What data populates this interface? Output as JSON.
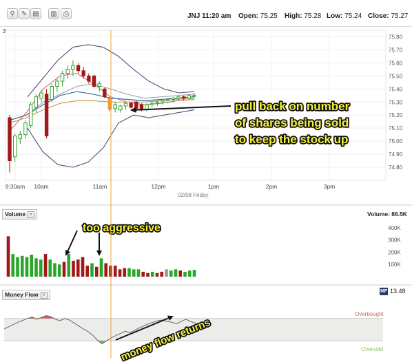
{
  "toolbar": {
    "buttons": [
      {
        "icon": "search-icon",
        "glyph": "⚲"
      },
      {
        "icon": "pencil-icon",
        "glyph": "✎"
      },
      {
        "icon": "document-icon",
        "glyph": "▤"
      },
      {
        "icon": "chart-icon",
        "glyph": "▥"
      },
      {
        "icon": "print-icon",
        "glyph": "⎙"
      }
    ]
  },
  "quote": {
    "symbol_time": "JNJ 11:20 am",
    "open_label": "Open:",
    "open": "75.25",
    "high_label": "High:",
    "high": "75.28",
    "low_label": "Low:",
    "low": "75.24",
    "close_label": "Close:",
    "close": "75.27"
  },
  "price_panel": {
    "corner_label": "3",
    "date_label": "02/08 Friday"
  },
  "volume_panel": {
    "title": "Volume",
    "value_label": "Volume: 86.5K"
  },
  "money_flow_panel": {
    "title": "Money Flow",
    "badge": "MF",
    "value": "13.48",
    "overbought_label": "Overbought",
    "oversold_label": "Oversold"
  },
  "annotations": {
    "pullback_lines": [
      "pull back on number",
      "of shares being sold",
      "to keep the stock up"
    ],
    "aggressive": "too aggressive",
    "money_flow": "money flow returns"
  },
  "colors": {
    "up": "#2aa62a",
    "down": "#a01818",
    "neutral": "#999999",
    "orange_marker": "#f0a030",
    "annotation_text": "#f5f03a"
  },
  "chart_data": [
    {
      "type": "candlestick",
      "x_ticks": [
        "9:30am",
        "10am",
        "11am",
        "12pm",
        "1pm",
        "2pm",
        "3pm"
      ],
      "ylim": [
        74.7,
        75.85
      ],
      "y_ticks": [
        74.8,
        74.9,
        75.0,
        75.1,
        75.2,
        75.3,
        75.4,
        75.5,
        75.6,
        75.7,
        75.8
      ],
      "y_tick_labels": [
        "74.80",
        "74.90",
        "75.00",
        "75.10",
        "75.20",
        "75.30",
        "75.40",
        "75.50",
        "75.60",
        "75.70",
        "75.80"
      ],
      "candles": [
        {
          "o": 75.18,
          "h": 75.2,
          "l": 74.76,
          "c": 74.85
        },
        {
          "o": 74.88,
          "h": 75.06,
          "l": 74.84,
          "c": 75.04
        },
        {
          "o": 75.02,
          "h": 75.08,
          "l": 74.98,
          "c": 75.05
        },
        {
          "o": 75.05,
          "h": 75.16,
          "l": 75.02,
          "c": 75.14
        },
        {
          "o": 75.12,
          "h": 75.3,
          "l": 75.1,
          "c": 75.28
        },
        {
          "o": 75.26,
          "h": 75.36,
          "l": 75.22,
          "c": 75.34
        },
        {
          "o": 75.33,
          "h": 75.39,
          "l": 75.3,
          "c": 75.37
        },
        {
          "o": 75.36,
          "h": 75.4,
          "l": 75.02,
          "c": 75.04
        },
        {
          "o": 75.32,
          "h": 75.44,
          "l": 75.3,
          "c": 75.42
        },
        {
          "o": 75.42,
          "h": 75.48,
          "l": 75.38,
          "c": 75.46
        },
        {
          "o": 75.46,
          "h": 75.54,
          "l": 75.42,
          "c": 75.52
        },
        {
          "o": 75.52,
          "h": 75.58,
          "l": 75.48,
          "c": 75.55
        },
        {
          "o": 75.55,
          "h": 75.62,
          "l": 75.5,
          "c": 75.58
        },
        {
          "o": 75.58,
          "h": 75.6,
          "l": 75.52,
          "c": 75.54
        },
        {
          "o": 75.54,
          "h": 75.57,
          "l": 75.48,
          "c": 75.5
        },
        {
          "o": 75.5,
          "h": 75.52,
          "l": 75.44,
          "c": 75.46
        },
        {
          "o": 75.5,
          "h": 75.51,
          "l": 75.41,
          "c": 75.42
        },
        {
          "o": 75.42,
          "h": 75.46,
          "l": 75.38,
          "c": 75.44
        },
        {
          "o": 75.4,
          "h": 75.41,
          "l": 75.33,
          "c": 75.34
        },
        {
          "o": 75.33,
          "h": 75.34,
          "l": 75.23,
          "c": 75.25
        },
        {
          "o": 75.25,
          "h": 75.3,
          "l": 75.22,
          "c": 75.28
        },
        {
          "o": 75.24,
          "h": 75.28,
          "l": 75.22,
          "c": 75.27
        },
        {
          "o": 75.27,
          "h": 75.3,
          "l": 75.24,
          "c": 75.29
        },
        {
          "o": 75.29,
          "h": 75.3,
          "l": 75.25,
          "c": 75.26
        },
        {
          "o": 75.3,
          "h": 75.31,
          "l": 75.22,
          "c": 75.25
        },
        {
          "o": 75.28,
          "h": 75.29,
          "l": 75.23,
          "c": 75.24
        },
        {
          "o": 75.24,
          "h": 75.29,
          "l": 75.23,
          "c": 75.28
        },
        {
          "o": 75.28,
          "h": 75.3,
          "l": 75.26,
          "c": 75.29
        },
        {
          "o": 75.29,
          "h": 75.31,
          "l": 75.27,
          "c": 75.3
        },
        {
          "o": 75.3,
          "h": 75.32,
          "l": 75.28,
          "c": 75.31
        },
        {
          "o": 75.31,
          "h": 75.33,
          "l": 75.29,
          "c": 75.32
        },
        {
          "o": 75.32,
          "h": 75.34,
          "l": 75.3,
          "c": 75.33
        },
        {
          "o": 75.33,
          "h": 75.35,
          "l": 75.31,
          "c": 75.34
        },
        {
          "o": 75.34,
          "h": 75.35,
          "l": 75.31,
          "c": 75.33
        },
        {
          "o": 75.33,
          "h": 75.36,
          "l": 75.32,
          "c": 75.35
        },
        {
          "o": 75.35,
          "h": 75.37,
          "l": 75.33,
          "c": 75.35
        }
      ],
      "bands_upper": [
        75.34,
        75.48,
        75.62,
        75.72,
        75.74,
        75.72,
        75.65,
        75.55,
        75.46,
        75.4,
        75.37,
        75.38
      ],
      "bands_lower": [
        75.1,
        74.92,
        74.82,
        74.8,
        74.84,
        74.95,
        75.14,
        75.2,
        75.18,
        75.2,
        75.22,
        75.24
      ],
      "ma_red": [
        75.08,
        75.22,
        75.4,
        75.5,
        75.52,
        75.44,
        75.34,
        75.3,
        75.28,
        75.29,
        75.31,
        75.32
      ],
      "ma_gray": [
        75.16,
        75.2,
        75.3,
        75.36,
        75.42,
        75.44,
        75.4,
        75.36,
        75.33,
        75.34,
        75.35,
        75.36
      ],
      "ma_blue": [
        75.16,
        75.2,
        75.28,
        75.35,
        75.38,
        75.36,
        75.33,
        75.32,
        75.31,
        75.32,
        75.33,
        75.34
      ],
      "ma_tan": [
        75.14,
        75.18,
        75.24,
        75.29,
        75.31,
        75.31,
        75.3,
        75.3,
        75.3,
        75.31,
        75.32,
        75.33
      ],
      "marker_time": "11:20 am"
    },
    {
      "type": "bar",
      "name": "Volume",
      "ylim": [
        0,
        450
      ],
      "y_ticks": [
        100,
        200,
        300,
        400
      ],
      "y_tick_labels": [
        "100K",
        "200K",
        "300K",
        "400K"
      ],
      "bars": [
        {
          "v": 330,
          "d": "down"
        },
        {
          "v": 185,
          "d": "up"
        },
        {
          "v": 160,
          "d": "up"
        },
        {
          "v": 170,
          "d": "up"
        },
        {
          "v": 160,
          "d": "up"
        },
        {
          "v": 180,
          "d": "up"
        },
        {
          "v": 150,
          "d": "up"
        },
        {
          "v": 140,
          "d": "up"
        },
        {
          "v": 185,
          "d": "down"
        },
        {
          "v": 140,
          "d": "up"
        },
        {
          "v": 110,
          "d": "up"
        },
        {
          "v": 100,
          "d": "up"
        },
        {
          "v": 120,
          "d": "down"
        },
        {
          "v": 185,
          "d": "up"
        },
        {
          "v": 130,
          "d": "down"
        },
        {
          "v": 140,
          "d": "down"
        },
        {
          "v": 160,
          "d": "down"
        },
        {
          "v": 90,
          "d": "down"
        },
        {
          "v": 110,
          "d": "up"
        },
        {
          "v": 80,
          "d": "down"
        },
        {
          "v": 150,
          "d": "up"
        },
        {
          "v": 110,
          "d": "down"
        },
        {
          "v": 90,
          "d": "down"
        },
        {
          "v": 90,
          "d": "down"
        },
        {
          "v": 60,
          "d": "down"
        },
        {
          "v": 70,
          "d": "down"
        },
        {
          "v": 70,
          "d": "up"
        },
        {
          "v": 60,
          "d": "up"
        },
        {
          "v": 60,
          "d": "up"
        },
        {
          "v": 40,
          "d": "down"
        },
        {
          "v": 30,
          "d": "down"
        },
        {
          "v": 40,
          "d": "up"
        },
        {
          "v": 30,
          "d": "down"
        },
        {
          "v": 40,
          "d": "down"
        },
        {
          "v": 60,
          "d": "neutral"
        },
        {
          "v": 50,
          "d": "up"
        },
        {
          "v": 60,
          "d": "up"
        },
        {
          "v": 50,
          "d": "down"
        },
        {
          "v": 40,
          "d": "up"
        },
        {
          "v": 50,
          "d": "up"
        },
        {
          "v": 55,
          "d": "up"
        }
      ]
    },
    {
      "type": "line",
      "name": "Money Flow",
      "ylim": [
        0,
        100
      ],
      "overbought": 80,
      "oversold": 20,
      "values": [
        52,
        58,
        64,
        70,
        75,
        80,
        84,
        78,
        83,
        88,
        85,
        78,
        74,
        80,
        76,
        68,
        60,
        52,
        45,
        35,
        22,
        12,
        20,
        28,
        34,
        40,
        46,
        42,
        48,
        55,
        60,
        66,
        70,
        74,
        76,
        72,
        70,
        66,
        72,
        78,
        72,
        68,
        62
      ]
    }
  ]
}
